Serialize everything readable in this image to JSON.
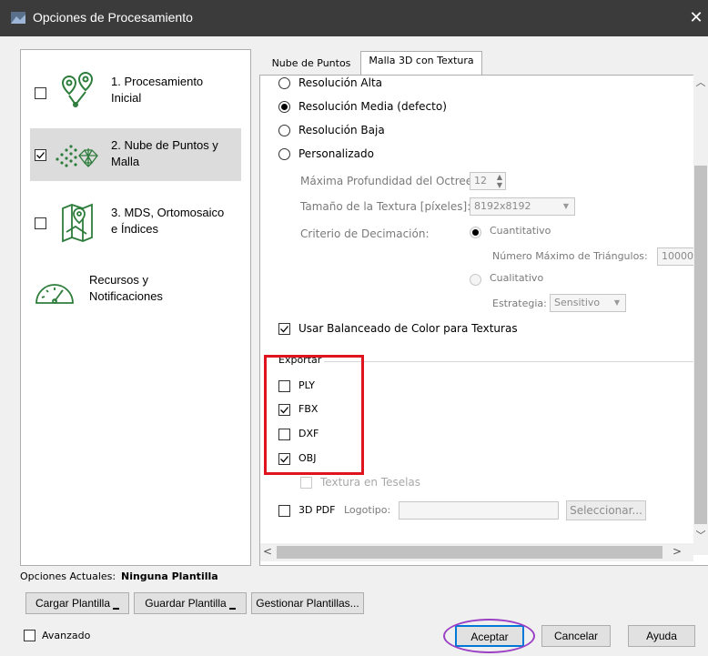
{
  "window": {
    "title": "Opciones de Procesamiento",
    "close_glyph": "✕"
  },
  "sidebar": {
    "items": [
      {
        "label_line1": "1. Procesamiento",
        "label_line2": "Inicial",
        "checked": false,
        "icon": "location-pins-icon"
      },
      {
        "label_line1": "2. Nube de Puntos y",
        "label_line2": "Malla",
        "checked": true,
        "icon": "point-cloud-icon"
      },
      {
        "label_line1": "3. MDS, Ortomosaico",
        "label_line2": "e Índices",
        "checked": false,
        "icon": "map-icon"
      },
      {
        "label_line1": "Recursos y",
        "label_line2": "Notificaciones",
        "icon": "gauge-icon"
      }
    ]
  },
  "tabs": [
    {
      "label": "Nube de Puntos",
      "active": false
    },
    {
      "label": "Malla 3D con Textura",
      "active": true
    }
  ],
  "resolution": {
    "options": [
      "Resolución Alta",
      "Resolución Media (defecto)",
      "Resolución Baja",
      "Personalizado"
    ],
    "selected": "Resolución Media (defecto)"
  },
  "custom": {
    "octree_label": "Máxima Profundidad del Octree:",
    "octree_value": "12",
    "texture_label": "Tamaño de la Textura [píxeles]:",
    "texture_value": "8192x8192",
    "decimation_label": "Criterio de Decimación:",
    "quant_label": "Cuantitativo",
    "max_triangles_label": "Número Máximo de Triángulos:",
    "max_triangles_value": "10000",
    "qual_label": "Cualitativo",
    "strategy_label": "Estrategia:",
    "strategy_value": "Sensitivo"
  },
  "color_balance": {
    "label": "Usar Balanceado de Color para Texturas",
    "checked": true
  },
  "export": {
    "title": "Exportar",
    "formats": [
      {
        "label": "PLY",
        "checked": false
      },
      {
        "label": "FBX",
        "checked": true
      },
      {
        "label": "DXF",
        "checked": false
      },
      {
        "label": "OBJ",
        "checked": true
      }
    ],
    "tiled_texture_label": "Textura en Teselas",
    "pdf_label": "3D PDF",
    "logo_label": "Logotipo:",
    "logo_value": "",
    "select_button": "Seleccionar..."
  },
  "footer": {
    "current_options_label": "Opciones Actuales:",
    "current_options_value": "Ninguna Plantilla",
    "load_template": "Cargar Plantilla",
    "save_template": "Guardar Plantilla",
    "manage_templates": "Gestionar Plantillas...",
    "advanced_label": "Avanzado",
    "accept": "Aceptar",
    "cancel": "Cancelar",
    "help": "Ayuda"
  },
  "colors": {
    "highlight_red": "#e0141e",
    "highlight_purple": "#9b3fc4",
    "accent_blue": "#0078d7"
  }
}
